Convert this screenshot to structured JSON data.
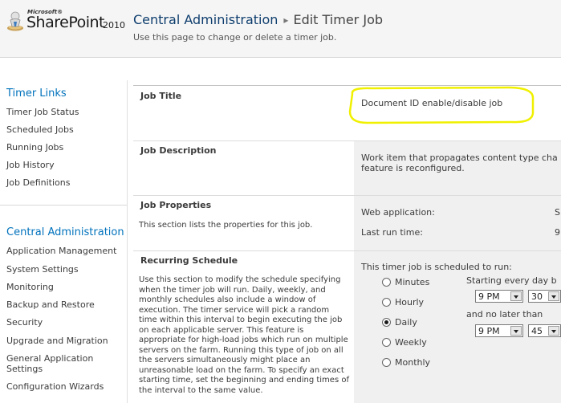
{
  "header": {
    "logo": {
      "microsoft": "Microsoft®",
      "product": "SharePoint",
      "year": "2010"
    },
    "breadcrumb_root": "Central Administration",
    "breadcrumb_separator": "▸",
    "breadcrumb_current": "Edit Timer Job",
    "description": "Use this page to change or delete a timer job."
  },
  "leftnav": {
    "timer_links": {
      "heading": "Timer Links",
      "items": [
        "Timer Job Status",
        "Scheduled Jobs",
        "Running Jobs",
        "Job History",
        "Job Definitions"
      ]
    },
    "central_admin": {
      "heading": "Central Administration",
      "items": [
        "Application Management",
        "System Settings",
        "Monitoring",
        "Backup and Restore",
        "Security",
        "Upgrade and Migration",
        "General Application Settings",
        "Configuration Wizards"
      ]
    }
  },
  "form": {
    "job_title": {
      "label": "Job Title",
      "value": "Document ID enable/disable job"
    },
    "job_description": {
      "label": "Job Description",
      "value_line1": "Work item that propagates content type cha",
      "value_line2": "feature is reconfigured."
    },
    "job_properties": {
      "label": "Job Properties",
      "help": "This section lists the properties for this job.",
      "web_application_label": "Web application:",
      "web_application_value": "S",
      "last_run_label": "Last run time:",
      "last_run_value": "9"
    },
    "recurring_schedule": {
      "label": "Recurring Schedule",
      "help": "Use this section to modify the schedule specifying when the timer job will run. Daily, weekly, and monthly schedules also include a window of execution. The timer service will pick a random time within this interval to begin executing the job on each applicable server. This feature is appropriate for high-load jobs which run on multiple servers on the farm. Running this type of job on all the servers simultaneously might place an unreasonable load on the farm. To specify an exact starting time, set the beginning and ending times of the interval to the same value.",
      "intro": "This timer job is scheduled to run:",
      "options": [
        "Minutes",
        "Hourly",
        "Daily",
        "Weekly",
        "Monthly"
      ],
      "selected": "Daily",
      "starting_label": "Starting every day b",
      "start_hour": "9 PM",
      "start_minute": "30",
      "no_later_label": "and no later than",
      "end_hour": "9 PM",
      "end_minute": "45"
    }
  },
  "colors": {
    "nav_heading": "#0072bc",
    "title_blue": "#0f3e6e",
    "highlight": "#f0f000"
  }
}
